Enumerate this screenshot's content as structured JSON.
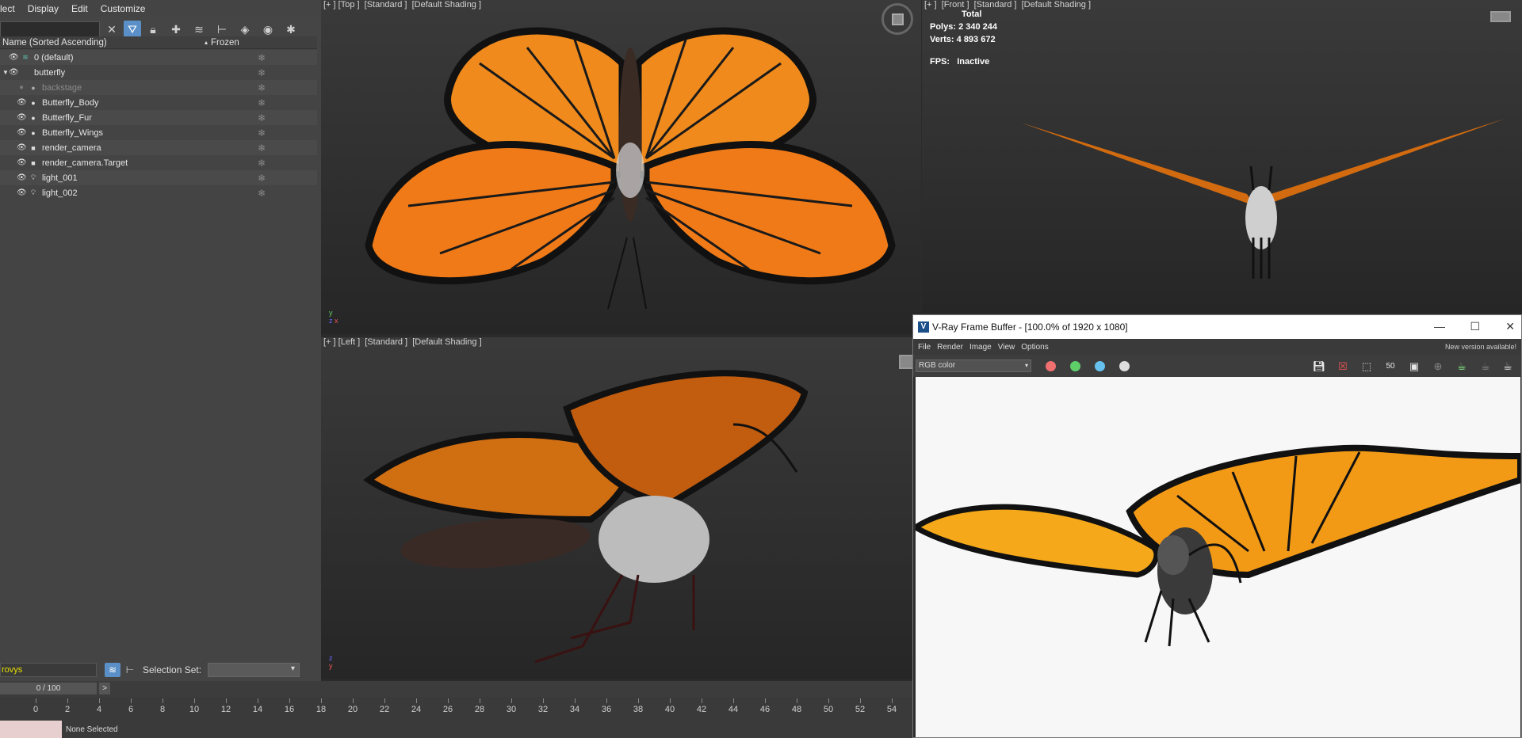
{
  "menubar": {
    "items": [
      "lect",
      "Display",
      "Edit",
      "Customize"
    ]
  },
  "explorer": {
    "header_name": "Name (Sorted Ascending)",
    "header_sort_indicator": "▴",
    "header_frozen": "Frozen",
    "rows": [
      {
        "label": "0 (default)"
      },
      {
        "label": "butterfly"
      },
      {
        "label": "backstage"
      },
      {
        "label": "Butterfly_Body"
      },
      {
        "label": "Butterfly_Fur"
      },
      {
        "label": "Butterfly_Wings"
      },
      {
        "label": "render_camera"
      },
      {
        "label": "render_camera.Target"
      },
      {
        "label": "light_001"
      },
      {
        "label": "light_002"
      }
    ],
    "filter_value": "rovys",
    "selection_set_label": "Selection Set:"
  },
  "viewports": {
    "top": {
      "label": "[+ ] [Top ]  [Standard ]  [Default Shading ]"
    },
    "front": {
      "label": "[+ ]  [Front ]  [Standard ]  [Default Shading ]",
      "stats_total": "Total",
      "polys_label": "Polys:",
      "polys_value": "2 340 244",
      "verts_label": "Verts:",
      "verts_value": "4 893 672",
      "fps_label": "FPS:",
      "fps_value": "Inactive"
    },
    "left": {
      "label": "[+ ] [Left ]  [Standard ]  [Default Shading ]"
    }
  },
  "vfb": {
    "title": "V-Ray Frame Buffer - [100.0% of 1920 x 1080]",
    "menu": [
      "File",
      "Render",
      "Image",
      "View",
      "Options"
    ],
    "notice": "New version available!",
    "channel": "RGB color",
    "zoom_icon_text": "50",
    "colors": {
      "red": "#f07070",
      "green": "#5fcf6a",
      "blue": "#67c1ee"
    }
  },
  "timeline": {
    "frame_display": "0 / 100",
    "next_label": ">",
    "ticks": [
      "0",
      "2",
      "4",
      "6",
      "8",
      "10",
      "12",
      "14",
      "16",
      "18",
      "20",
      "22",
      "24",
      "26",
      "28",
      "30",
      "32",
      "34",
      "36",
      "38",
      "40",
      "42",
      "44",
      "46",
      "48",
      "50",
      "52",
      "54"
    ]
  },
  "status": {
    "text": "None Selected"
  }
}
